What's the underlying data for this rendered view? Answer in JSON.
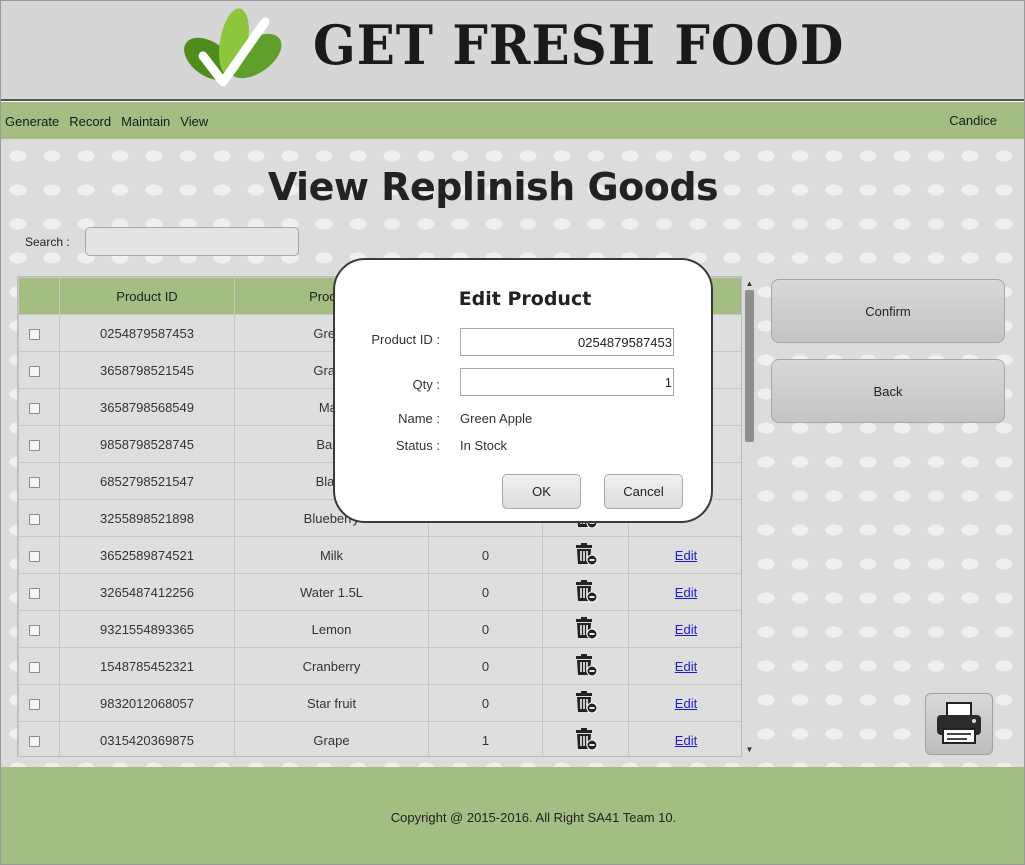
{
  "brand": {
    "name": "GET FRESH FOOD"
  },
  "menu": {
    "items": [
      "Generate",
      "Record",
      "Maintain",
      "View"
    ],
    "user": "Candice"
  },
  "page": {
    "title": "View Replinish Goods"
  },
  "search": {
    "label": "Search :",
    "value": ""
  },
  "table": {
    "columns": [
      "",
      "Product ID",
      "Product",
      "",
      "",
      ""
    ],
    "rows": [
      {
        "id": "0254879587453",
        "name": "Green",
        "qty": "",
        "action": ""
      },
      {
        "id": "3658798521545",
        "name": "Grape",
        "qty": "",
        "action": ""
      },
      {
        "id": "3658798568549",
        "name": "Man",
        "qty": "",
        "action": ""
      },
      {
        "id": "9858798528745",
        "name": "Bana",
        "qty": "",
        "action": ""
      },
      {
        "id": "6852798521547",
        "name": "Black",
        "qty": "",
        "action": ""
      },
      {
        "id": "3255898521898",
        "name": "Blueberry",
        "qty": "",
        "action": ""
      },
      {
        "id": "3652589874521",
        "name": "Milk",
        "qty": "0",
        "action": "Edit"
      },
      {
        "id": "3265487412256",
        "name": "Water 1.5L",
        "qty": "0",
        "action": "Edit"
      },
      {
        "id": "9321554893365",
        "name": "Lemon",
        "qty": "0",
        "action": "Edit"
      },
      {
        "id": "1548785452321",
        "name": "Cranberry",
        "qty": "0",
        "action": "Edit"
      },
      {
        "id": "9832012068057",
        "name": "Star fruit",
        "qty": "0",
        "action": "Edit"
      },
      {
        "id": "0315420369875",
        "name": "Grape",
        "qty": "1",
        "action": "Edit"
      }
    ]
  },
  "actions": {
    "confirm": "Confirm",
    "back": "Back"
  },
  "dialog": {
    "title": "Edit Product",
    "product_id_label": "Product ID :",
    "product_id_value": "0254879587453",
    "qty_label": "Qty :",
    "qty_value": "1",
    "name_label": "Name :",
    "name_value": "Green Apple",
    "status_label": "Status :",
    "status_value": "In Stock",
    "ok": "OK",
    "cancel": "Cancel"
  },
  "footer": {
    "copyright": "Copyright @ 2015-2016. All Right SA41 Team 10."
  },
  "colors": {
    "accent_green": "#a3bd83",
    "link": "#1c1ccf",
    "header_bg": "#d6d6d6"
  }
}
